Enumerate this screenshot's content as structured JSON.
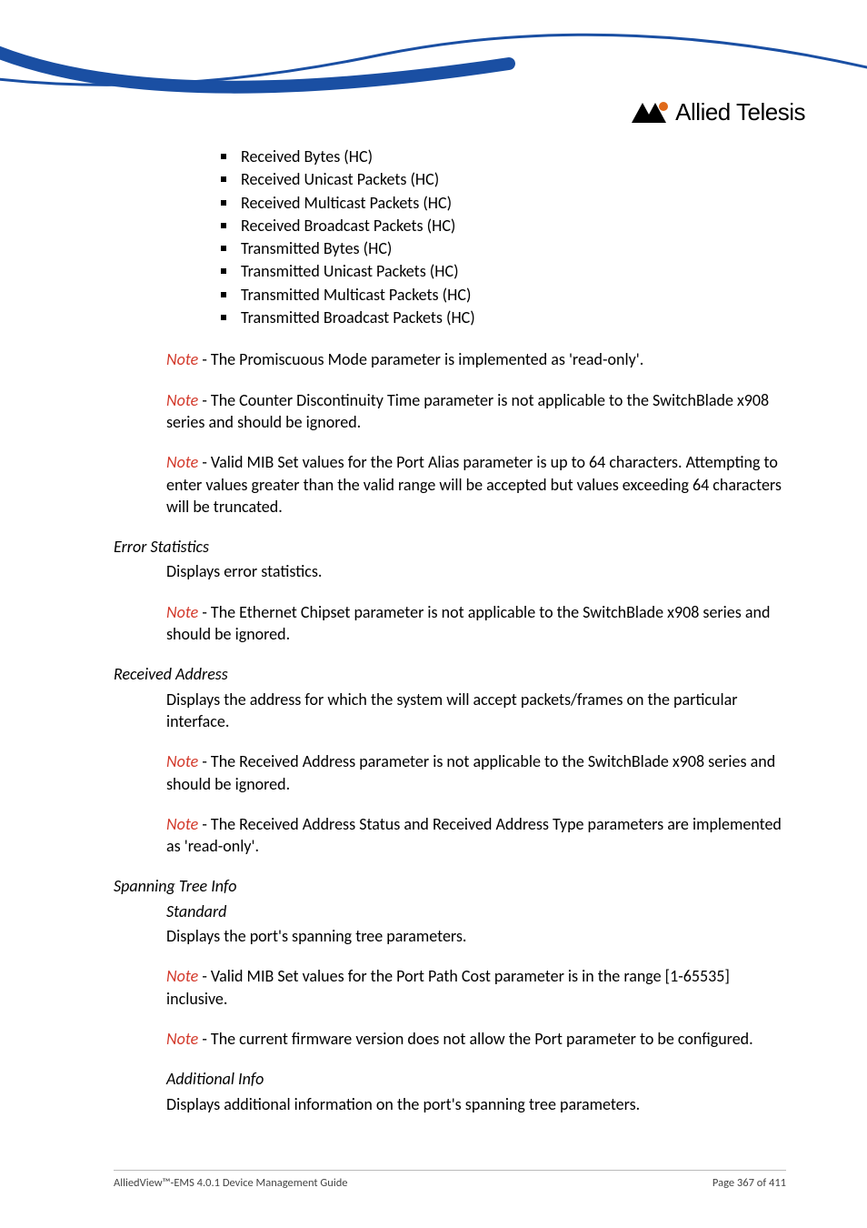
{
  "logo": {
    "text": "Allied Telesis"
  },
  "bullets": [
    "Received Bytes (HC)",
    "Received Unicast Packets (HC)",
    "Received Multicast Packets (HC)",
    "Received Broadcast Packets (HC)",
    "Transmitted Bytes (HC)",
    "Transmitted Unicast Packets (HC)",
    "Transmitted Multicast Packets (HC)",
    "Transmitted Broadcast Packets (HC)"
  ],
  "notes": {
    "n1_label": "Note",
    "n1_text": " - The Promiscuous Mode parameter is implemented as 'read-only'.",
    "n2_label": "Note",
    "n2_text": " - The Counter Discontinuity Time parameter is not applicable to the SwitchBlade x908 series and should be ignored.",
    "n3_label": "Note",
    "n3_text": " - Valid MIB Set values for the Port Alias parameter is up to 64 characters. Attempting to enter values greater than the valid range will be accepted but values exceeding 64 characters will be truncated."
  },
  "error_stats": {
    "heading": "Error Statistics",
    "body": "Displays error statistics.",
    "note_label": "Note",
    "note_text": " - The Ethernet Chipset parameter is not applicable to the SwitchBlade x908 series and should be ignored."
  },
  "recv_addr": {
    "heading": "Received Address",
    "body": "Displays the address for which the system will accept packets/frames on the particular interface.",
    "note1_label": "Note",
    "note1_text": " - The Received Address parameter is not applicable to the SwitchBlade x908 series and should be ignored.",
    "note2_label": "Note",
    "note2_text": " - The Received Address Status and Received Address Type parameters are implemented as 'read-only'."
  },
  "span_tree": {
    "heading": "Spanning Tree Info",
    "sub1": "Standard",
    "body1": "Displays the port's spanning tree parameters.",
    "note1_label": "Note",
    "note1_text": " - Valid MIB Set values for the Port Path Cost parameter is in the range [1-65535] inclusive.",
    "note2_label": "Note",
    "note2_text": " - The current firmware version does not allow the Port parameter to be configured.",
    "sub2": "Additional Info",
    "body2": "Displays additional information on the port's spanning tree parameters."
  },
  "footer": {
    "left": "AlliedView™-EMS 4.0.1 Device Management Guide",
    "right": "Page 367 of 411"
  }
}
